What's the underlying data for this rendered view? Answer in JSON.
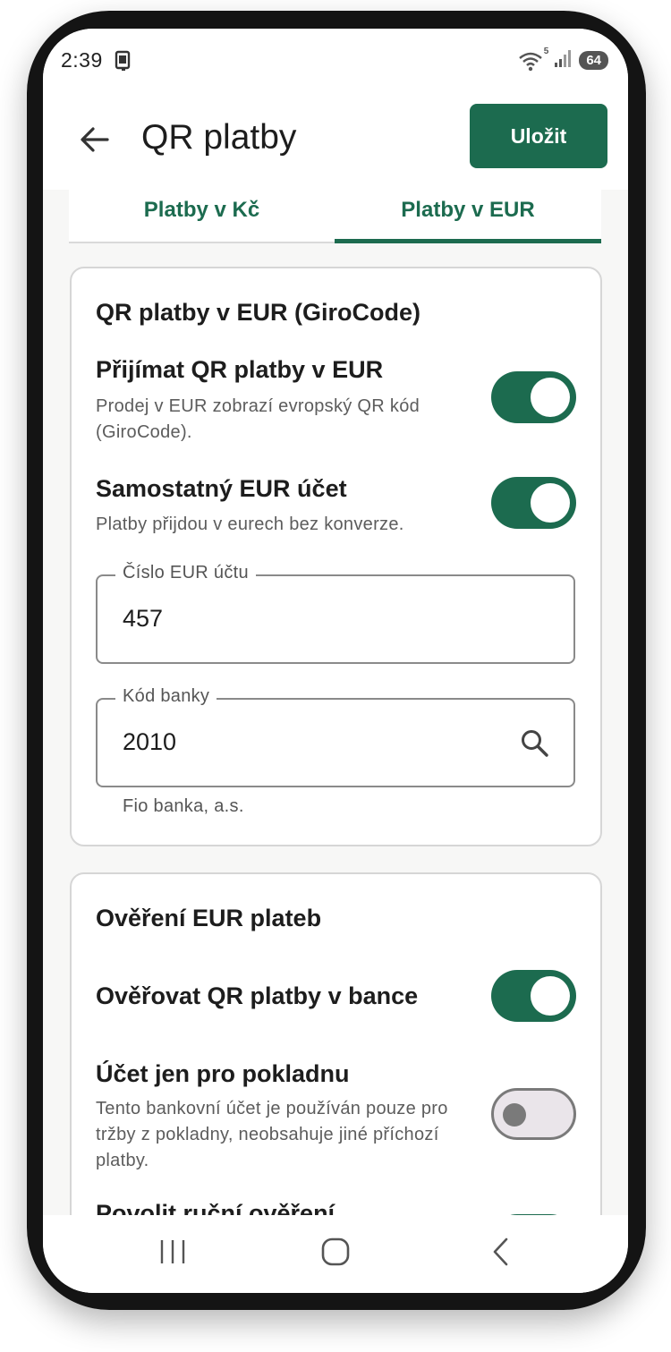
{
  "status_bar": {
    "time": "2:39",
    "battery": "64",
    "wifi_badge": "5",
    "icons": [
      "device-icon",
      "wifi-icon",
      "signal-icon",
      "battery-icon"
    ]
  },
  "app_bar": {
    "title": "QR platby",
    "save_label": "Uložit",
    "back_icon": "arrow-left-icon"
  },
  "tabs": [
    {
      "label": "Platby v Kč",
      "selected": false
    },
    {
      "label": "Platby v EUR",
      "selected": true
    }
  ],
  "eur_card": {
    "title": "QR platby v EUR (GiroCode)",
    "accept": {
      "title": "Přijímat QR platby v EUR",
      "desc_line1": "Prodej v EUR zobrazí evropský QR kód",
      "desc_line2": "(GiroCode).",
      "enabled": true
    },
    "separate_account": {
      "title": "Samostatný EUR účet",
      "desc": "Platby přijdou v eurech bez konverze.",
      "enabled": true
    },
    "account_number": {
      "label": "Číslo EUR účtu",
      "value": "457"
    },
    "bank_code": {
      "label": "Kód banky",
      "value": "2010",
      "helper": "Fio banka, a.s."
    }
  },
  "verify_card": {
    "title": "Ověření EUR plateb",
    "verify_in_bank": {
      "title": "Ověřovat QR platby v bance",
      "enabled": true
    },
    "account_for_register": {
      "title": "Účet jen pro pokladnu",
      "desc_line1": "Tento bankovní účet je používán pouze pro",
      "desc_line2": "tržby z pokladny, neobsahuje jiné příchozí",
      "desc_line3": "platby.",
      "enabled": false
    },
    "manual_verify": {
      "title": "Povolit ruční ověření"
    }
  },
  "colors": {
    "accent": "#1c6b4f",
    "switch_off_track": "#eae5ea",
    "switch_off_knob": "#7a7a7a",
    "background": "#f7f7f6"
  },
  "nav_bar": {
    "icons": [
      "recents-icon",
      "home-icon",
      "back-nav-icon"
    ]
  }
}
